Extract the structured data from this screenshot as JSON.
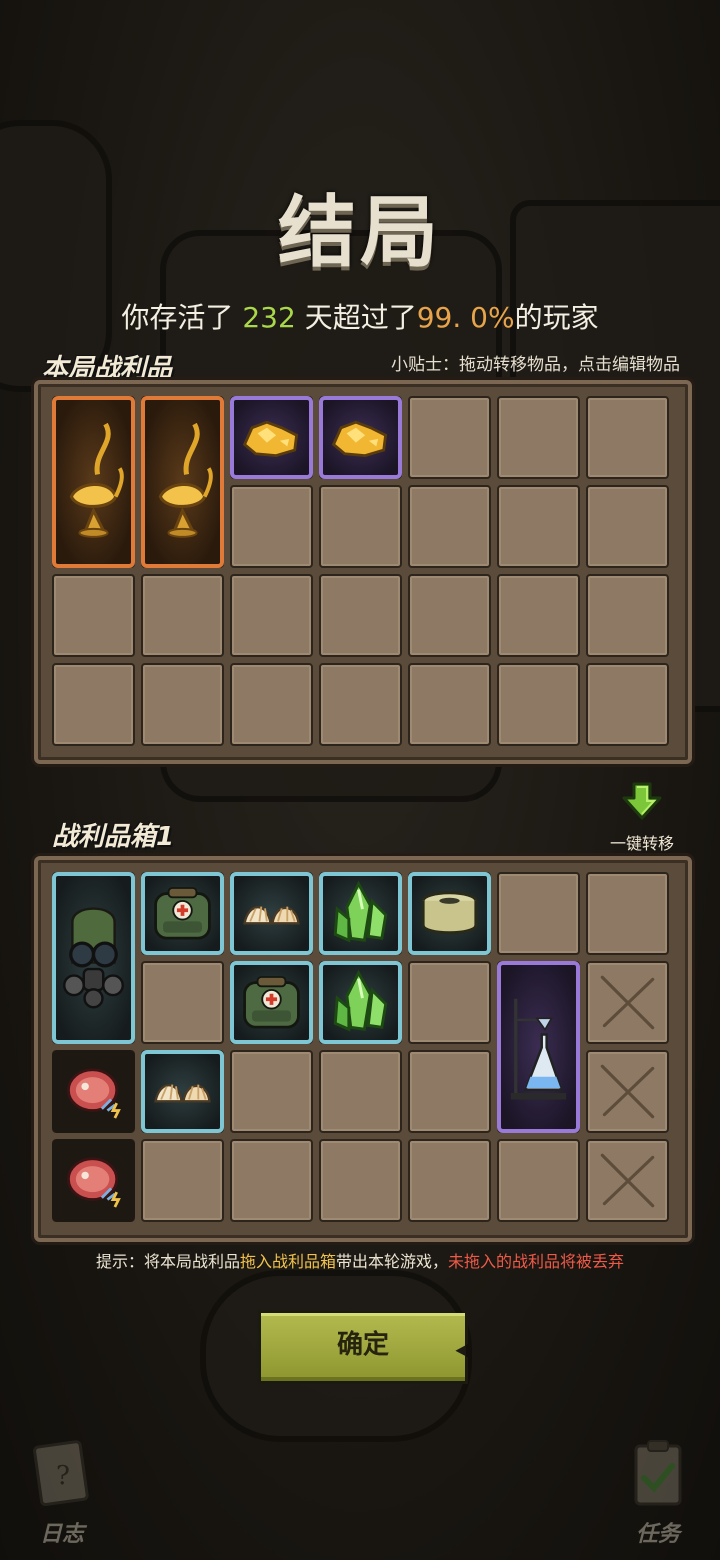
{
  "header": {
    "title": "结局",
    "survive_prefix": "你存活了",
    "days": "232",
    "survive_mid": "天超过了",
    "percent": "99. 0%",
    "survive_suffix": "的玩家"
  },
  "tip_top": "小贴士：拖动转移物品，点击编辑物品",
  "loot_panel": {
    "label": "本局战利品",
    "items": [
      {
        "icon": "golden-lamp-icon",
        "rarity": "orange"
      },
      {
        "icon": "golden-lamp-icon",
        "rarity": "orange"
      },
      {
        "icon": "gold-nugget-icon",
        "rarity": "purple"
      },
      {
        "icon": "gold-nugget-icon",
        "rarity": "purple"
      }
    ]
  },
  "box_panel": {
    "label": "战利品箱1",
    "items": [
      {
        "icon": "gas-mask-icon",
        "rarity": "cyan"
      },
      {
        "icon": "medic-backpack-icon",
        "rarity": "cyan"
      },
      {
        "icon": "shell-icon",
        "rarity": "cyan"
      },
      {
        "icon": "green-crystal-icon",
        "rarity": "cyan"
      },
      {
        "icon": "tape-roll-icon",
        "rarity": "cyan"
      },
      {
        "icon": "medic-backpack-icon",
        "rarity": "cyan"
      },
      {
        "icon": "green-crystal-icon",
        "rarity": "cyan"
      },
      {
        "icon": "lab-flask-icon",
        "rarity": "purple"
      },
      {
        "icon": "raw-meat-icon",
        "rarity": "none"
      },
      {
        "icon": "shell-icon",
        "rarity": "cyan"
      },
      {
        "icon": "raw-meat-icon",
        "rarity": "none"
      }
    ],
    "locked_icon": "locked-slot-icon"
  },
  "transfer": {
    "label": "一键转移",
    "icon": "down-arrow-icon"
  },
  "hint": {
    "prefix": "提示：将本局战利品",
    "highlight": "拖入战利品箱",
    "middle": "带出本轮游戏，",
    "warning": "未拖入的战利品将被丢弃"
  },
  "confirm_label": "确定",
  "corners": {
    "log_label": "日志",
    "task_label": "任务"
  },
  "colors": {
    "green": "#a9d84a",
    "orange": "#e7a44a",
    "yellow": "#f0c24c",
    "red": "#ef5a48",
    "confirm": "#a3ab42"
  }
}
